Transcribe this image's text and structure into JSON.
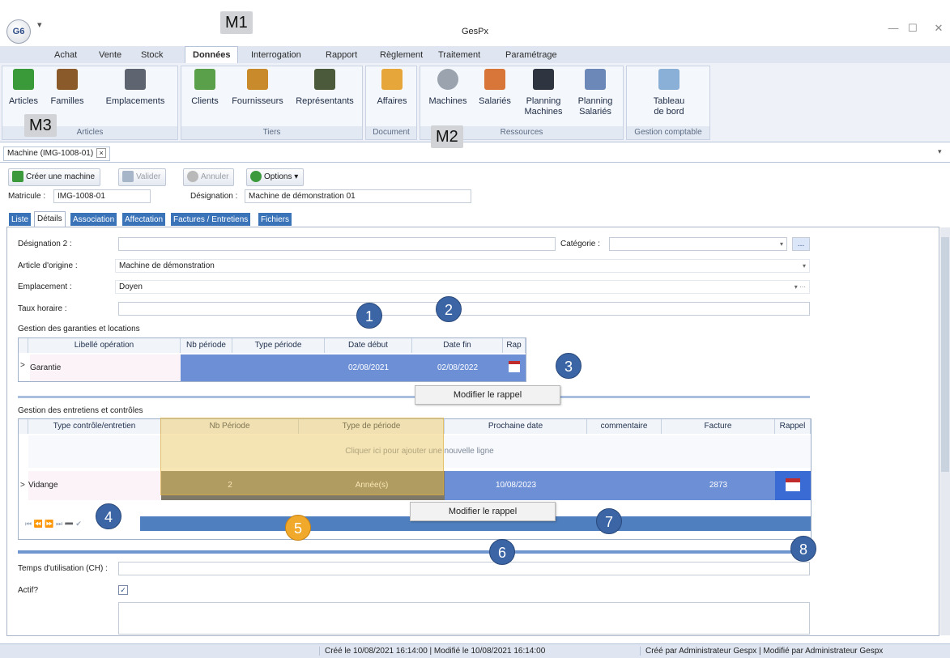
{
  "window": {
    "title": "GesPx",
    "app_badge": "G6",
    "qat": "▾",
    "minimize": "—",
    "maximize": "☐",
    "close": "✕"
  },
  "ribbon_tabs": [
    "Achat",
    "Vente",
    "Stock",
    "Données",
    "Interrogation",
    "Rapport",
    "Règlement",
    "Traitement",
    "Paramétrage"
  ],
  "ribbon": {
    "groups": [
      {
        "title": "Articles",
        "buttons": [
          "Articles",
          "Familles",
          "Emplacements"
        ]
      },
      {
        "title": "Tiers",
        "buttons": [
          "Clients",
          "Fournisseurs",
          "Représentants"
        ]
      },
      {
        "title": "Document",
        "buttons": [
          "Affaires"
        ]
      },
      {
        "title": "Ressources",
        "buttons": [
          "Machines",
          "Salariés",
          "Planning\nMachines",
          "Planning\nSalariés"
        ]
      },
      {
        "title": "Gestion comptable",
        "buttons": [
          "Tableau\nde bord"
        ]
      }
    ]
  },
  "doc_tab": {
    "label": "Machine (IMG-1008-01)",
    "close": "×",
    "dropdown": "▾"
  },
  "toolbar": {
    "create": "Créer une machine",
    "validate": "Valider",
    "cancel": "Annuler",
    "options": "Options",
    "options_arrow": "▾"
  },
  "header_fields": {
    "matricule_label": "Matricule :",
    "matricule_value": "IMG-1008-01",
    "designation_label": "Désignation :",
    "designation_value": "Machine de démonstration 01"
  },
  "detail_tabs": [
    "Liste",
    "Détails",
    "Association",
    "Affectation",
    "Factures / Entretiens",
    "Fichiers"
  ],
  "form": {
    "designation2_label": "Désignation 2 :",
    "designation2_value": "",
    "categorie_label": "Catégorie :",
    "categorie_value": "",
    "ellipsis": "...",
    "article_label": "Article d'origine :",
    "article_value": "Machine de démonstration",
    "emplacement_label": "Emplacement :",
    "emplacement_value": "Doyen",
    "taux_label": "Taux horaire :",
    "taux_value": "",
    "temps_label": "Temps d'utilisation (CH) :",
    "temps_value": "",
    "actif_label": "Actif?",
    "actif_checked": true,
    "check_mark": "✓"
  },
  "garanties": {
    "title": "Gestion des garanties et locations",
    "columns": [
      "Libellé opération",
      "Nb période",
      "Type période",
      "Date début",
      "Date fin",
      "Rap"
    ],
    "row": {
      "arrow": ">",
      "libelle": "Garantie",
      "nb": "",
      "type": "",
      "debut": "02/08/2021",
      "fin": "02/08/2022"
    }
  },
  "entretiens": {
    "title": "Gestion des entretiens et contrôles",
    "columns": [
      "Type contrôle/entretien",
      "Nb Période",
      "Type de période",
      "Prochaine date",
      "commentaire",
      "Facture",
      "Rappel"
    ],
    "add_row": "Cliquer ici pour ajouter une nouvelle ligne",
    "row": {
      "arrow": ">",
      "type": "Vidange",
      "nb": "2",
      "periode": "Année(s)",
      "date": "10/08/2023",
      "commentaire": "",
      "facture": "2873"
    },
    "nav": "⏮ ⏪ ⏩ ⏭ ➖ ✔"
  },
  "context_menu": {
    "label": "Modifier le rappel"
  },
  "callouts": {
    "c1": "1",
    "c2": "2",
    "c3": "3",
    "c4": "4",
    "c5": "5",
    "c6": "6",
    "c7": "7",
    "c8": "8",
    "m1": "M1",
    "m2": "M2",
    "m3": "M3"
  },
  "status": {
    "created": "Créé le 10/08/2021 16:14:00 | Modifié le 10/08/2021 16:14:00",
    "by": "Créé par Administrateur Gespx | Modifié par Administrateur Gespx"
  },
  "colors": {
    "accent": "#3b73b9",
    "selected": "#6d8fd6",
    "callout": "#3b65a5",
    "callout_orange": "#f0a92a"
  }
}
